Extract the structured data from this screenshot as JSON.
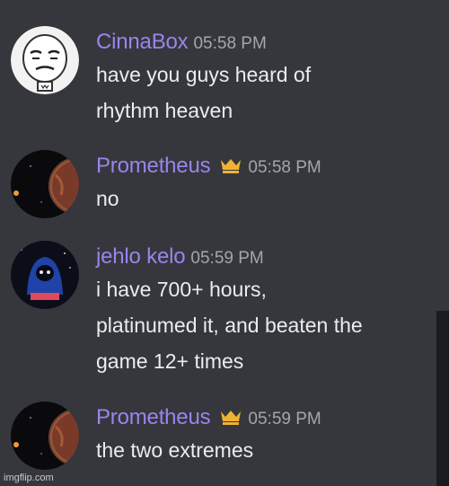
{
  "messages": [
    {
      "username": "CinnaBox",
      "timestamp": "05:58 PM",
      "text": "have you guys heard of\nrhythm heaven",
      "avatar": "meme-face-avatar",
      "has_crown": false
    },
    {
      "username": "Prometheus",
      "timestamp": "05:58 PM",
      "text": "no",
      "avatar": "planet-avatar",
      "has_crown": true
    },
    {
      "username": "jehlo kelo",
      "timestamp": "05:59 PM",
      "text": "i have 700+ hours,\nplatinumed it, and beaten the\ngame 12+ times",
      "avatar": "blue-hooded-character-avatar",
      "has_crown": false
    },
    {
      "username": "Prometheus",
      "timestamp": "05:59 PM",
      "text": "the two extremes",
      "avatar": "planet-avatar",
      "has_crown": true
    }
  ],
  "watermark": "imgflip.com",
  "colors": {
    "background": "#35373c",
    "username": "#9b84ec",
    "timestamp": "#a3a6aa",
    "text": "#ececee",
    "crown": "#f0b232"
  }
}
